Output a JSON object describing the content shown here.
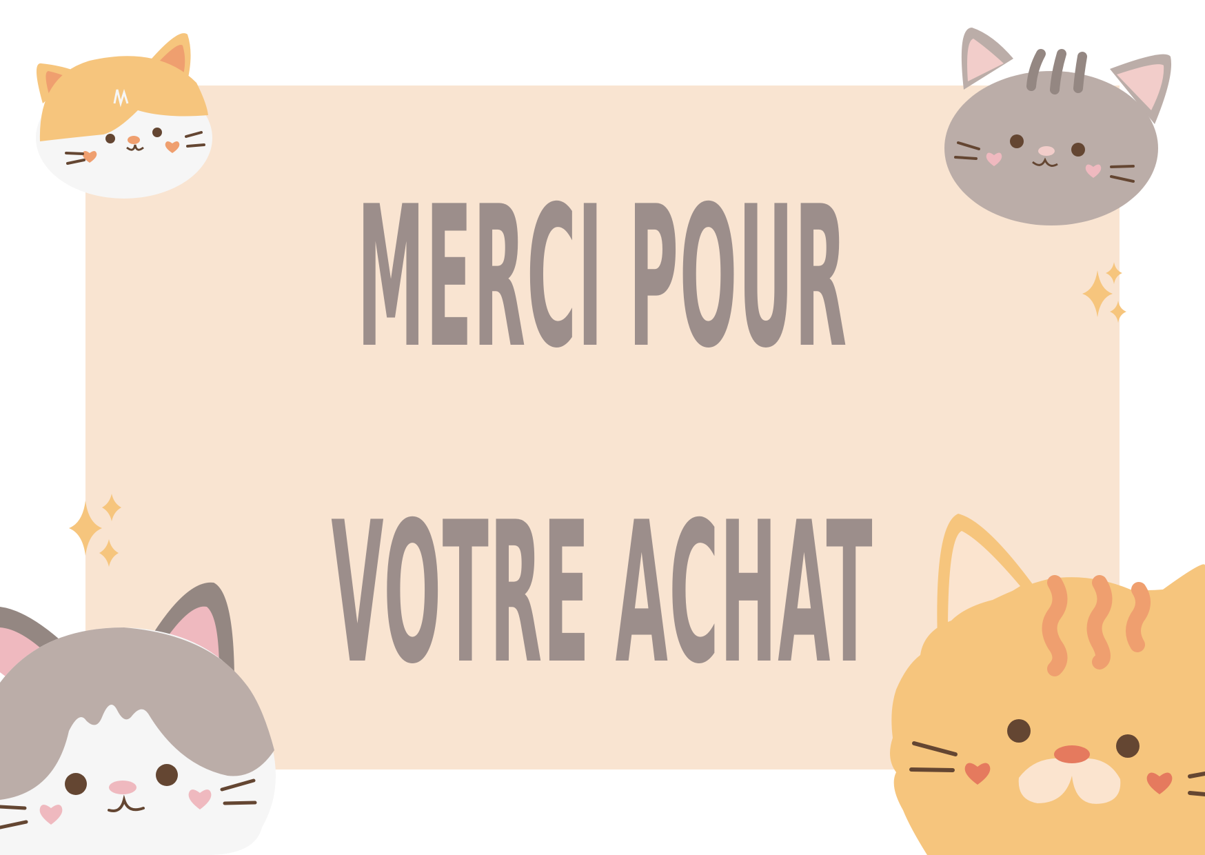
{
  "card": {
    "line1": "MERCI POUR",
    "line2": "VOTRE ACHAT"
  },
  "colors": {
    "background": "#ffffff",
    "card": "#f9e4d1",
    "text": "#9c8e8b",
    "orange_cat": "#f6c57d",
    "gray_cat": "#bbada8",
    "white_fur": "#f6f6f6",
    "eyes": "#644632",
    "blush_pink": "#efb9bf",
    "blush_orange": "#ef9f6f",
    "stripe_orange": "#ef9f6f",
    "sparkle": "#f6c57d"
  },
  "decorations": {
    "icons": [
      "cat-head-orange-white-icon",
      "cat-head-gray-tabby-icon",
      "cat-face-gray-white-icon",
      "cat-face-orange-tabby-icon",
      "sparkle-icon"
    ]
  }
}
